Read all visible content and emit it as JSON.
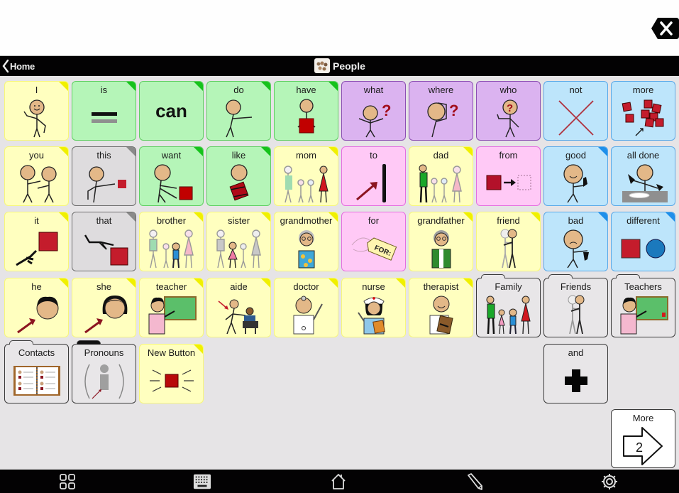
{
  "message_bar": {
    "text": "",
    "clear_icon": "backspace-x-icon"
  },
  "nav": {
    "back_label": "Home",
    "back_icon": "chevron-left-icon",
    "title": "People",
    "title_icon": "people-thumbnail-icon"
  },
  "colors": {
    "yellow": "#ffffbf",
    "green": "#b5f5b8",
    "purple": "#dbb3f0",
    "blue": "#bde5fb",
    "pink": "#ffc9f6",
    "gray": "#dedcde",
    "corner_yellow": "#f0f000",
    "corner_green": "#16c21c",
    "corner_blue": "#1f8fea",
    "corner_gray": "#8a8a8a"
  },
  "cells": [
    {
      "label": "I",
      "icon": "person-pointing-self-icon"
    },
    {
      "label": "is",
      "icon": "equals-icon"
    },
    {
      "label": "can",
      "icon": "can-text-icon"
    },
    {
      "label": "do",
      "icon": "person-reaching-icon"
    },
    {
      "label": "have",
      "icon": "person-holding-box-icon"
    },
    {
      "label": "what",
      "icon": "person-question-shrug-icon"
    },
    {
      "label": "where",
      "icon": "person-looking-question-icon"
    },
    {
      "label": "who",
      "icon": "question-face-icon"
    },
    {
      "label": "not",
      "icon": "x-cross-icon"
    },
    {
      "label": "more",
      "icon": "more-squares-icon"
    },
    {
      "label": "you",
      "icon": "two-people-pointing-icon"
    },
    {
      "label": "this",
      "icon": "person-pointing-square-icon"
    },
    {
      "label": "want",
      "icon": "person-reaching-square-icon"
    },
    {
      "label": "like",
      "icon": "person-hugging-square-icon"
    },
    {
      "label": "mom",
      "icon": "family-mom-highlight-icon"
    },
    {
      "label": "to",
      "icon": "arrow-to-line-icon"
    },
    {
      "label": "dad",
      "icon": "family-dad-highlight-icon"
    },
    {
      "label": "from",
      "icon": "square-arrow-dotted-icon"
    },
    {
      "label": "good",
      "icon": "thumbs-up-person-icon"
    },
    {
      "label": "all done",
      "icon": "person-plate-done-icon"
    },
    {
      "label": "it",
      "icon": "hand-pointing-square-icon"
    },
    {
      "label": "that",
      "icon": "hand-pointing-far-square-icon"
    },
    {
      "label": "brother",
      "icon": "family-brother-highlight-icon"
    },
    {
      "label": "sister",
      "icon": "family-sister-highlight-icon"
    },
    {
      "label": "grandmother",
      "icon": "grandmother-icon"
    },
    {
      "label": "for",
      "icon": "gift-tag-for-icon"
    },
    {
      "label": "grandfather",
      "icon": "grandfather-icon"
    },
    {
      "label": "friend",
      "icon": "two-friends-icon"
    },
    {
      "label": "bad",
      "icon": "thumbs-down-person-icon"
    },
    {
      "label": "different",
      "icon": "square-and-circle-icon"
    },
    {
      "label": "he",
      "icon": "boy-face-arrow-icon"
    },
    {
      "label": "she",
      "icon": "girl-face-arrow-icon"
    },
    {
      "label": "teacher",
      "icon": "teacher-chalkboard-icon"
    },
    {
      "label": "aide",
      "icon": "aide-helping-student-icon"
    },
    {
      "label": "doctor",
      "icon": "doctor-icon"
    },
    {
      "label": "nurse",
      "icon": "nurse-icon"
    },
    {
      "label": "therapist",
      "icon": "therapist-clipboard-icon"
    },
    {
      "label": "Family",
      "icon": "family-folder-icon"
    },
    {
      "label": "Friends",
      "icon": "friends-folder-icon"
    },
    {
      "label": "Teachers",
      "icon": "teachers-folder-icon"
    },
    {
      "label": "Contacts",
      "icon": "address-book-icon"
    },
    {
      "label": "Pronouns",
      "icon": "pronoun-person-icon"
    },
    {
      "label": "New Button",
      "icon": "new-button-burst-icon"
    },
    {
      "label": "and",
      "icon": "plus-icon"
    },
    {
      "label": "More",
      "icon": "arrow-right-page-icon",
      "page": "2"
    }
  ],
  "toolbar": [
    {
      "name": "grid-icon"
    },
    {
      "name": "keyboard-icon"
    },
    {
      "name": "home-icon"
    },
    {
      "name": "pencil-icon"
    },
    {
      "name": "gear-icon"
    }
  ]
}
